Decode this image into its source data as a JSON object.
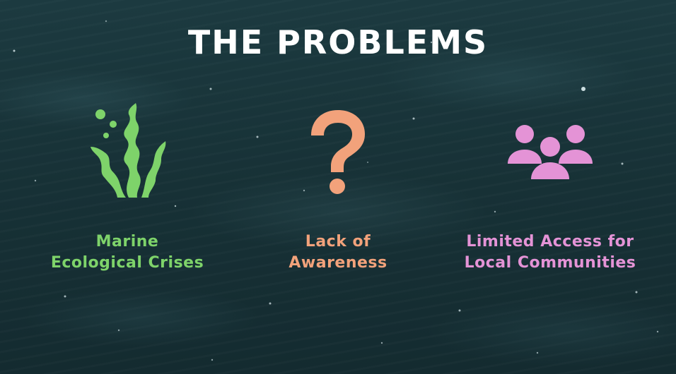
{
  "title": "THE PROBLEMS",
  "problems": [
    {
      "line1": "Marine",
      "line2": "Ecological Crises",
      "icon": "seaweed-icon",
      "color": "#7ed36a"
    },
    {
      "line1": "Lack of",
      "line2": "Awareness",
      "icon": "question-mark-icon",
      "color": "#f2a27b"
    },
    {
      "line1": "Limited Access for",
      "line2": "Local Communities",
      "icon": "group-people-icon",
      "color": "#e493d6"
    }
  ]
}
